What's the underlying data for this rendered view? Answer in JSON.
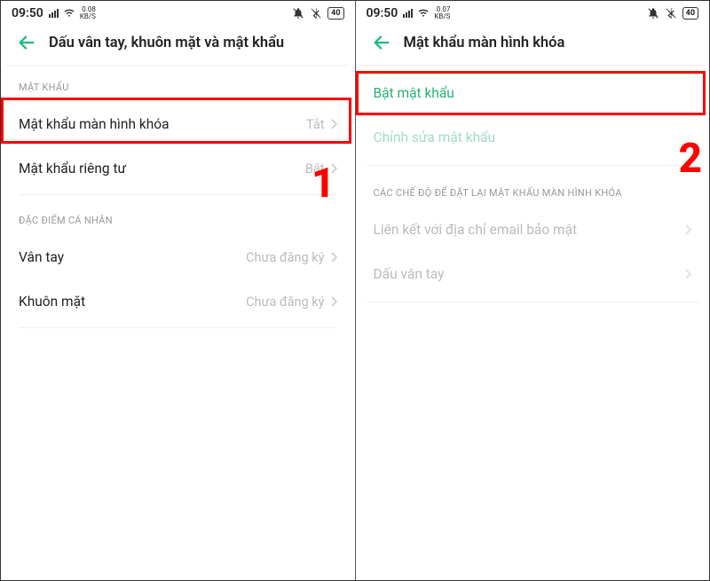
{
  "left": {
    "status": {
      "time": "09:50",
      "kb_top": "0.08",
      "kb_bot": "KB/S",
      "battery": "40"
    },
    "header": {
      "title": "Dấu vân tay, khuôn mặt và mật khẩu"
    },
    "section1": {
      "header": "MẬT KHẨU"
    },
    "rows1": [
      {
        "title": "Mật khẩu màn hình khóa",
        "value": "Tắt"
      },
      {
        "title": "Mật khẩu riêng tư",
        "value": "Bật"
      }
    ],
    "section2": {
      "header": "ĐẶC ĐIỂM CÁ NHÂN"
    },
    "rows2": [
      {
        "title": "Vân tay",
        "value": "Chưa đăng ký"
      },
      {
        "title": "Khuôn mặt",
        "value": "Chưa đăng ký"
      }
    ],
    "step": "1"
  },
  "right": {
    "status": {
      "time": "09:50",
      "kb_top": "0.07",
      "kb_bot": "KB/S",
      "battery": "40"
    },
    "header": {
      "title": "Mật khẩu màn hình khóa"
    },
    "rows1": [
      {
        "title": "Bật mật khẩu"
      },
      {
        "title": "Chỉnh sửa mật khẩu"
      }
    ],
    "section2": {
      "header": "CÁC CHẾ ĐỘ ĐỂ ĐẶT LẠI MẬT KHẨU MÀN HÌNH KHÓA"
    },
    "rows2": [
      {
        "title": "Liên kết với địa chỉ email bảo mật"
      },
      {
        "title": "Dấu vân tay"
      }
    ],
    "step": "2"
  }
}
